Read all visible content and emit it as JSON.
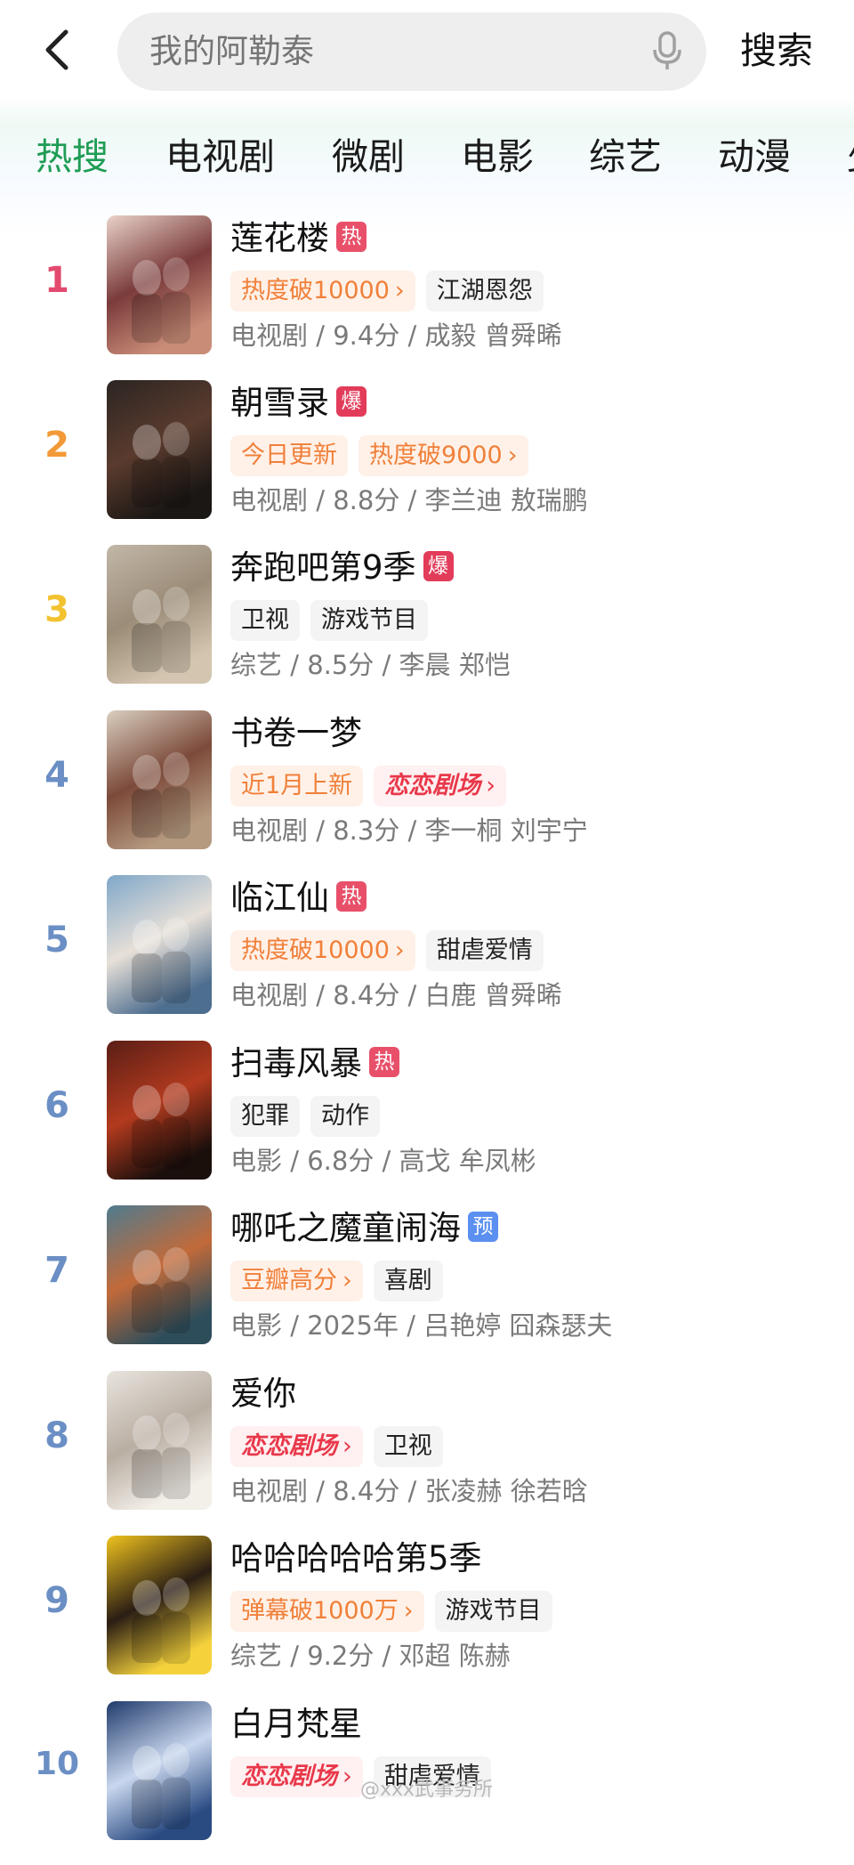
{
  "header": {
    "back_icon": "chevron-left-icon",
    "search_placeholder": "我的阿勒泰",
    "mic_icon": "microphone-icon",
    "search_button": "搜索"
  },
  "tabs": [
    {
      "label": "热搜",
      "active": true
    },
    {
      "label": "电视剧",
      "active": false
    },
    {
      "label": "微剧",
      "active": false
    },
    {
      "label": "电影",
      "active": false
    },
    {
      "label": "综艺",
      "active": false
    },
    {
      "label": "动漫",
      "active": false
    },
    {
      "label": "少",
      "active": false
    }
  ],
  "colors": {
    "accent_green": "#1f9d55",
    "rank1": "#e24a6e",
    "rank2": "#f29a37",
    "rank3": "#f2c230",
    "rank_other": "#6b8fc4",
    "badge_hot": "#e8506a",
    "badge_burst": "#e23c5a",
    "badge_pre": "#5b8ff0",
    "tag_hot_text": "#f0803a"
  },
  "items": [
    {
      "rank": "1",
      "title": "莲花楼",
      "badge": "热",
      "badge_type": "hot",
      "tags": [
        {
          "text": "热度破10000",
          "style": "hot",
          "arrow": "›"
        },
        {
          "text": "江湖恩怨",
          "style": "plain",
          "arrow": ""
        }
      ],
      "meta": "电视剧 / 9.4分 / 成毅 曾舜晞"
    },
    {
      "rank": "2",
      "title": "朝雪录",
      "badge": "爆",
      "badge_type": "burst",
      "tags": [
        {
          "text": "今日更新",
          "style": "hot",
          "arrow": ""
        },
        {
          "text": "热度破9000",
          "style": "hot",
          "arrow": "›"
        }
      ],
      "meta": "电视剧 / 8.8分 / 李兰迪 敖瑞鹏"
    },
    {
      "rank": "3",
      "title": "奔跑吧第9季",
      "badge": "爆",
      "badge_type": "burst",
      "tags": [
        {
          "text": "卫视",
          "style": "plain",
          "arrow": ""
        },
        {
          "text": "游戏节目",
          "style": "plain",
          "arrow": ""
        }
      ],
      "meta": "综艺 / 8.5分 / 李晨 郑恺"
    },
    {
      "rank": "4",
      "title": "书卷一梦",
      "badge": "",
      "badge_type": "",
      "tags": [
        {
          "text": "近1月上新",
          "style": "hot",
          "arrow": ""
        },
        {
          "text": "恋恋剧场",
          "style": "brand",
          "arrow": "›"
        }
      ],
      "meta": "电视剧 / 8.3分 / 李一桐 刘宇宁"
    },
    {
      "rank": "5",
      "title": "临江仙",
      "badge": "热",
      "badge_type": "hot",
      "tags": [
        {
          "text": "热度破10000",
          "style": "hot",
          "arrow": "›"
        },
        {
          "text": "甜虐爱情",
          "style": "plain",
          "arrow": ""
        }
      ],
      "meta": "电视剧 / 8.4分 / 白鹿 曾舜晞"
    },
    {
      "rank": "6",
      "title": "扫毒风暴",
      "badge": "热",
      "badge_type": "hot",
      "tags": [
        {
          "text": "犯罪",
          "style": "plain",
          "arrow": ""
        },
        {
          "text": "动作",
          "style": "plain",
          "arrow": ""
        }
      ],
      "meta": "电影 / 6.8分 / 高戈 牟凤彬"
    },
    {
      "rank": "7",
      "title": "哪吒之魔童闹海",
      "badge": "预",
      "badge_type": "pre",
      "tags": [
        {
          "text": "豆瓣高分",
          "style": "hot",
          "arrow": "›"
        },
        {
          "text": "喜剧",
          "style": "plain",
          "arrow": ""
        }
      ],
      "meta": "电影 / 2025年 / 吕艳婷 囧森瑟夫"
    },
    {
      "rank": "8",
      "title": "爱你",
      "badge": "",
      "badge_type": "",
      "tags": [
        {
          "text": "恋恋剧场",
          "style": "brand",
          "arrow": "›"
        },
        {
          "text": "卫视",
          "style": "plain",
          "arrow": ""
        }
      ],
      "meta": "电视剧 / 8.4分 / 张凌赫 徐若晗"
    },
    {
      "rank": "9",
      "title": "哈哈哈哈哈第5季",
      "badge": "",
      "badge_type": "",
      "tags": [
        {
          "text": "弹幕破1000万",
          "style": "hot",
          "arrow": "›"
        },
        {
          "text": "游戏节目",
          "style": "plain",
          "arrow": ""
        }
      ],
      "meta": "综艺 / 9.2分 / 邓超 陈赫"
    },
    {
      "rank": "10",
      "title": "白月梵星",
      "badge": "",
      "badge_type": "",
      "tags": [
        {
          "text": "恋恋剧场",
          "style": "brand",
          "arrow": "›"
        },
        {
          "text": "甜虐爱情",
          "style": "plain",
          "arrow": ""
        }
      ],
      "meta": ""
    }
  ],
  "watermark": "@xxx武事务所"
}
